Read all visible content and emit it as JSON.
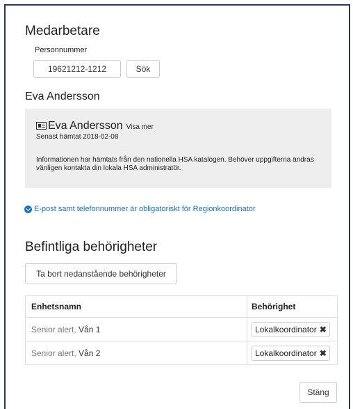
{
  "section_title": "Medarbetare",
  "personnummer": {
    "label": "Personnummer",
    "value": "19621212-1212"
  },
  "search_button": "Sök",
  "person_heading": "Eva Andersson",
  "info_card": {
    "name": "Eva Andersson",
    "more_link": "Visa mer",
    "fetched": "Senast hämtat 2018-02-08",
    "description": "Informationen har hämtats från den nationella HSA katalogen. Behöver uppgifterna ändras vänligen kontakta din lokala HSA administratör."
  },
  "notice": "E-post samt telefonnummer är obligatoriskt för Regionkoordinator",
  "permissions": {
    "title": "Befintliga behörigheter",
    "remove_button": "Ta bort nedanstående behörigheter",
    "columns": [
      "Enhetsnamn",
      "Behörighet"
    ],
    "rows": [
      {
        "unit_prefix": "Senior alert,",
        "unit_suffix": " Vån 1",
        "role": "Lokalkoordinator"
      },
      {
        "unit_prefix": "Senior alert,",
        "unit_suffix": " Vån 2",
        "role": "Lokalkoordinator"
      }
    ]
  },
  "close_button": "Stäng",
  "colors": {
    "accent": "#1a73c9",
    "frame": "#1f3864",
    "panel_bg": "#eeeeee"
  }
}
